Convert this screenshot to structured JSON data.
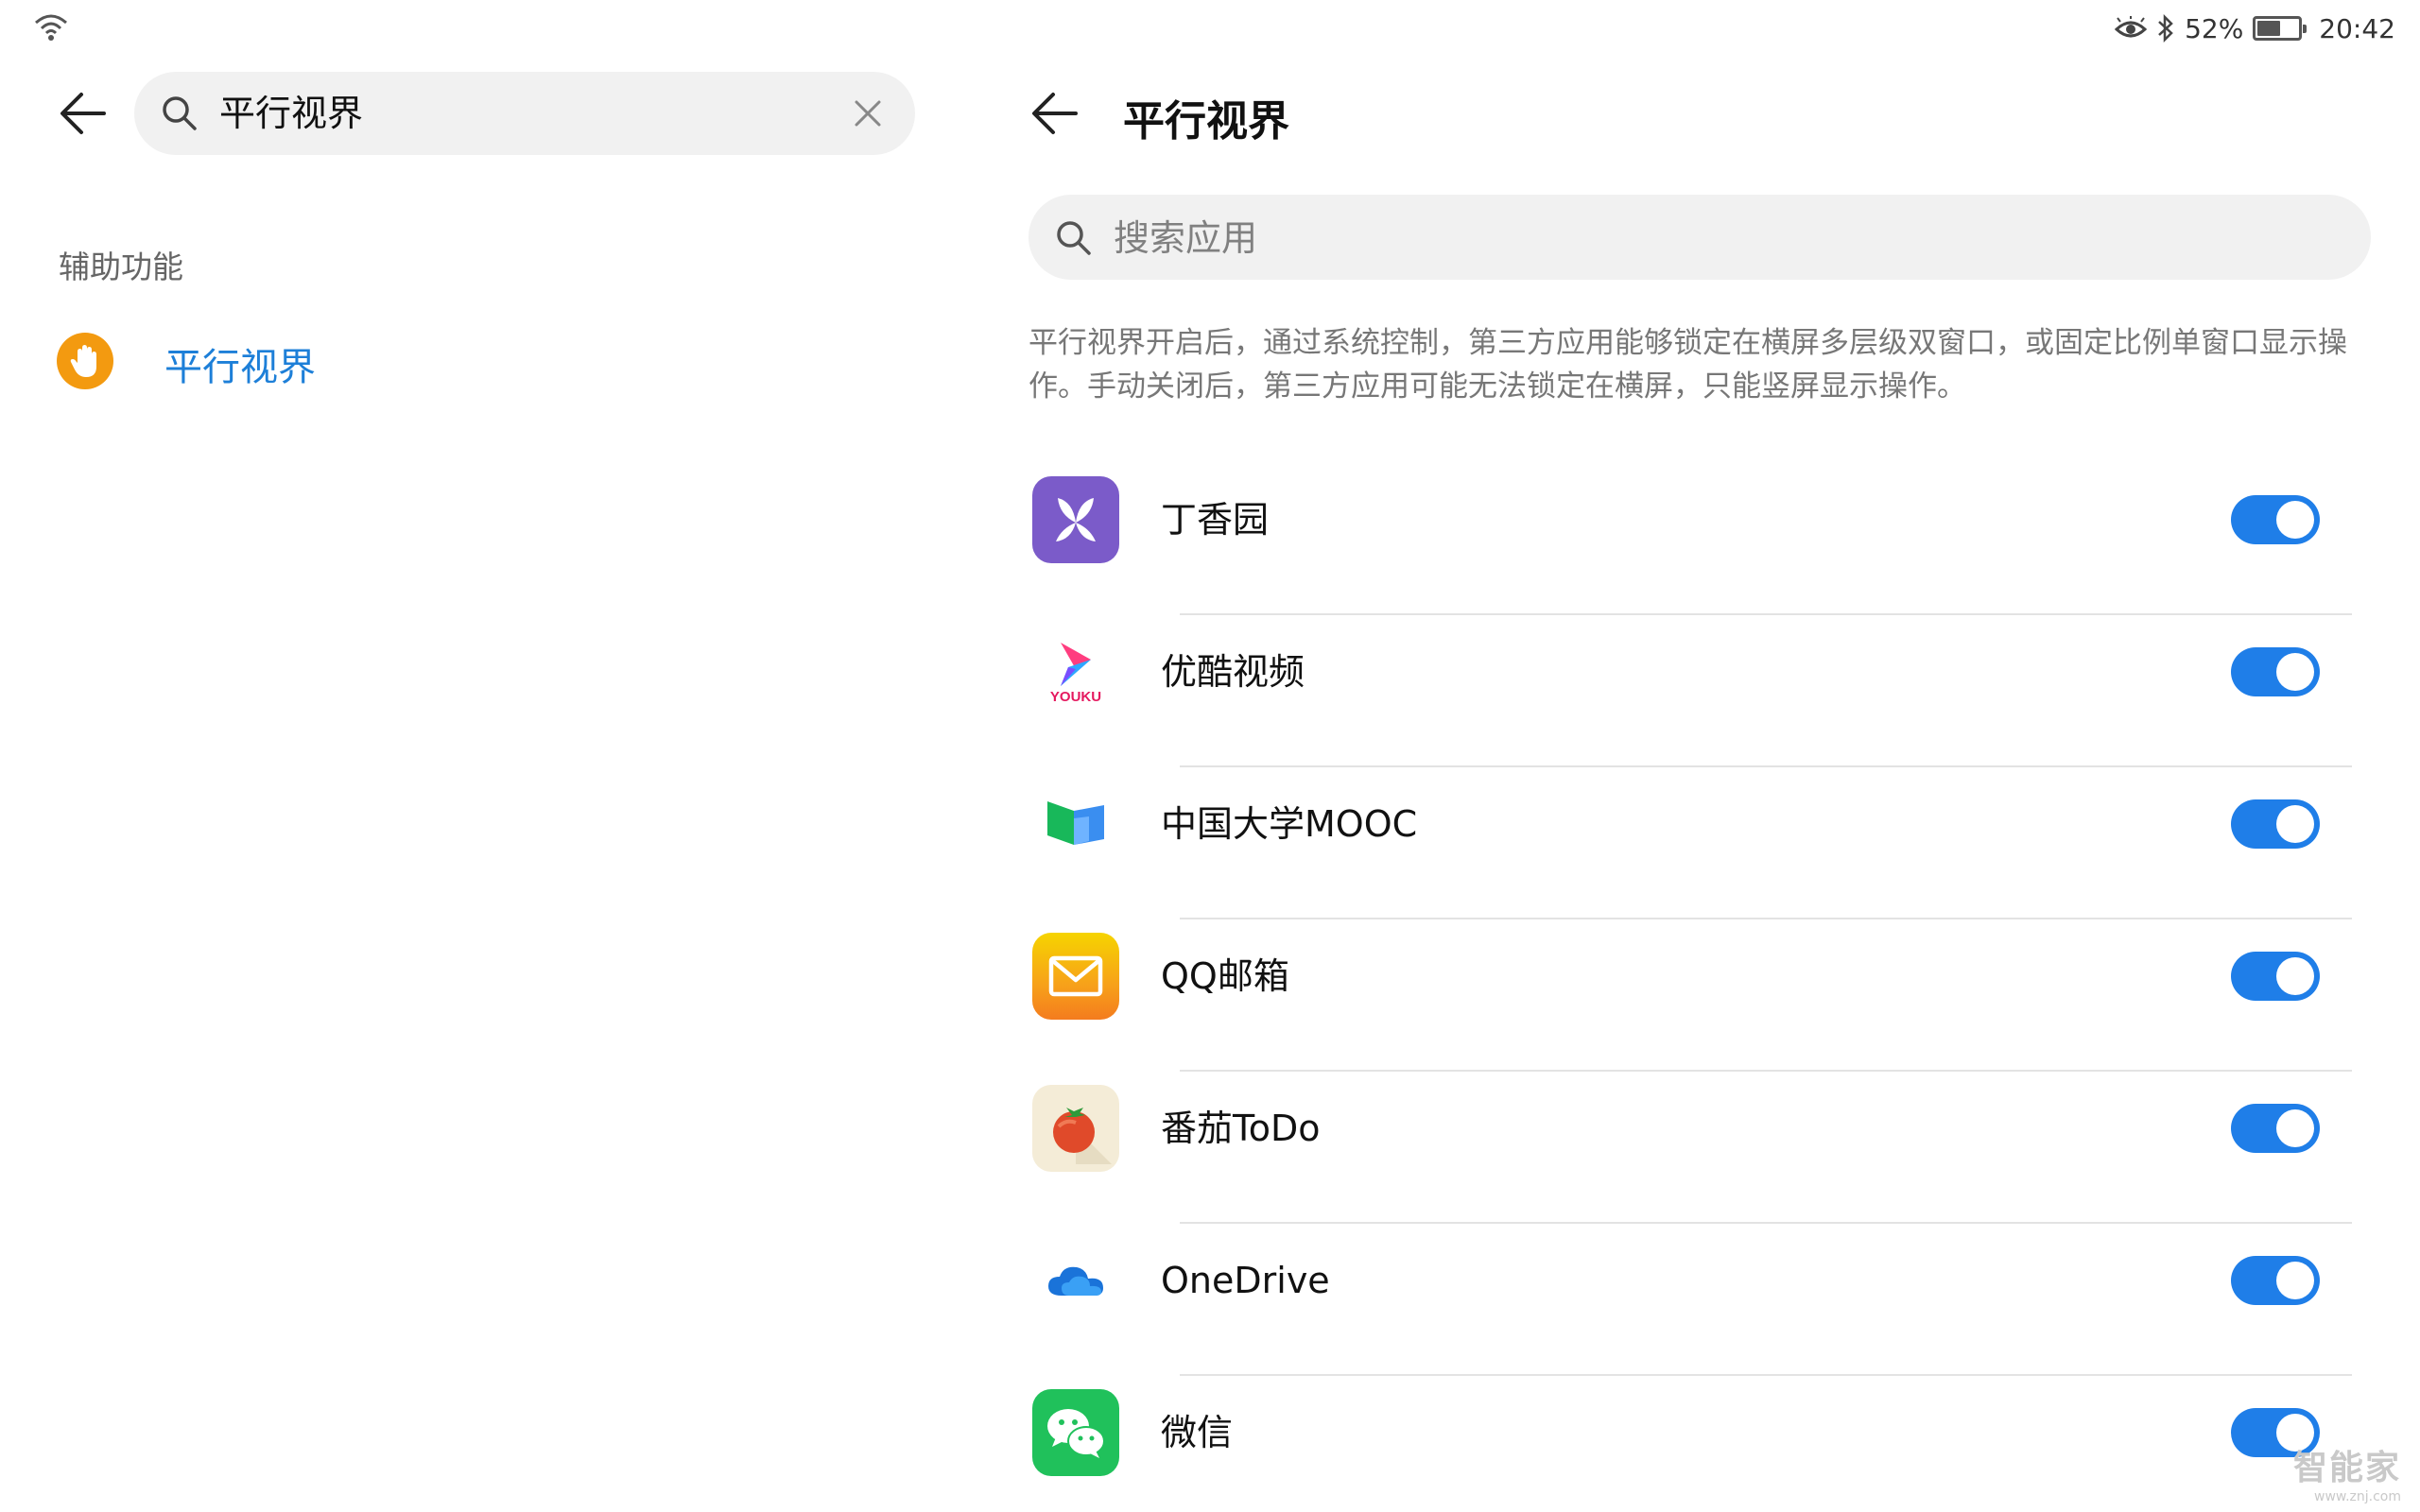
{
  "status_bar": {
    "battery_percent": "52%",
    "battery_level": 0.52,
    "time": "20:42",
    "icons": [
      "wifi-icon",
      "eye-comfort-icon",
      "bluetooth-icon",
      "battery-icon"
    ]
  },
  "left_pane": {
    "search_value": "平行视界",
    "section_label": "辅助功能",
    "result_label": "平行视界",
    "result_icon": "hand-icon",
    "result_icon_color": "#f39a10",
    "result_label_color": "#1d7fd8"
  },
  "right_pane": {
    "title": "平行视界",
    "search_placeholder": "搜索应用",
    "description": "平行视界开启后，通过系统控制，第三方应用能够锁定在横屏多层级双窗口，或固定比例单窗口显示操作。手动关闭后，第三方应用可能无法锁定在横屏，只能竖屏显示操作。",
    "toggle_color": "#1f7ee8",
    "apps": [
      {
        "name": "丁香园",
        "icon": "dingxiangyuan-icon",
        "enabled": true
      },
      {
        "name": "优酷视频",
        "icon": "youku-icon",
        "icon_text": "YOUKU",
        "enabled": true
      },
      {
        "name": "中国大学MOOC",
        "icon": "mooc-icon",
        "enabled": true
      },
      {
        "name": "QQ邮箱",
        "icon": "qqmail-icon",
        "enabled": true
      },
      {
        "name": "番茄ToDo",
        "icon": "tomato-todo-icon",
        "enabled": true
      },
      {
        "name": "OneDrive",
        "icon": "onedrive-icon",
        "enabled": true
      },
      {
        "name": "微信",
        "icon": "wechat-icon",
        "enabled": true
      }
    ]
  },
  "watermark": {
    "line1": "智能家",
    "line2": "www.znj.com"
  }
}
